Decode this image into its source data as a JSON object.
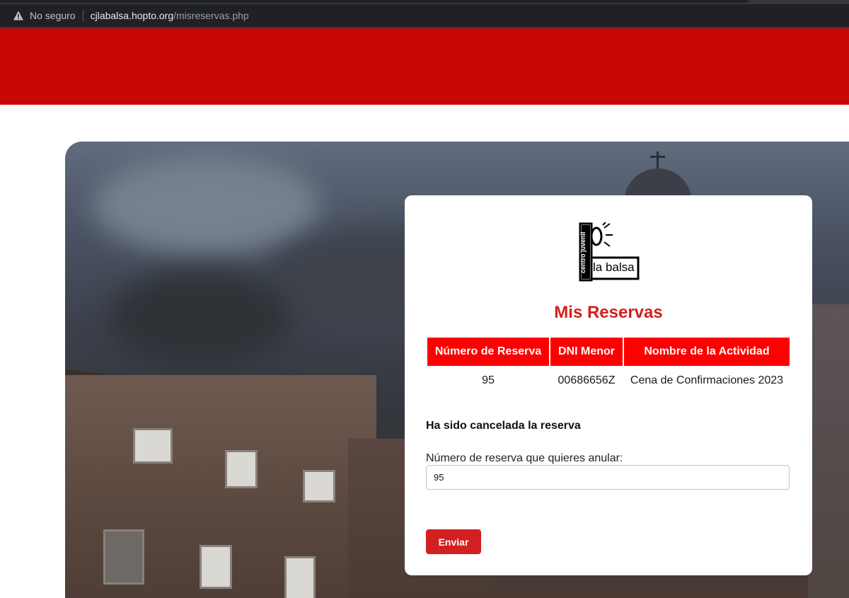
{
  "browser": {
    "security_label": "No seguro",
    "url_host": "cjlabalsa.hopto.org",
    "url_path": "/misreservas.php"
  },
  "logo": {
    "text_main": "la balsa",
    "text_vertical": "centro juvenil"
  },
  "page": {
    "title": "Mis Reservas"
  },
  "table": {
    "headers": [
      "Número de Reserva",
      "DNI Menor",
      "Nombre de la Actividad"
    ],
    "rows": [
      [
        "95",
        "00686656Z",
        "Cena de Confirmaciones 2023"
      ]
    ]
  },
  "status_message": "Ha sido cancelada la reserva",
  "form": {
    "label": "Número de reserva que quieres anular:",
    "input_value": "95",
    "submit_label": "Enviar"
  },
  "colors": {
    "header_red": "#c80606",
    "accent_red": "#d21f1f",
    "table_header_red": "#ff0000"
  },
  "icons": {
    "security": "warning-triangle-icon"
  }
}
